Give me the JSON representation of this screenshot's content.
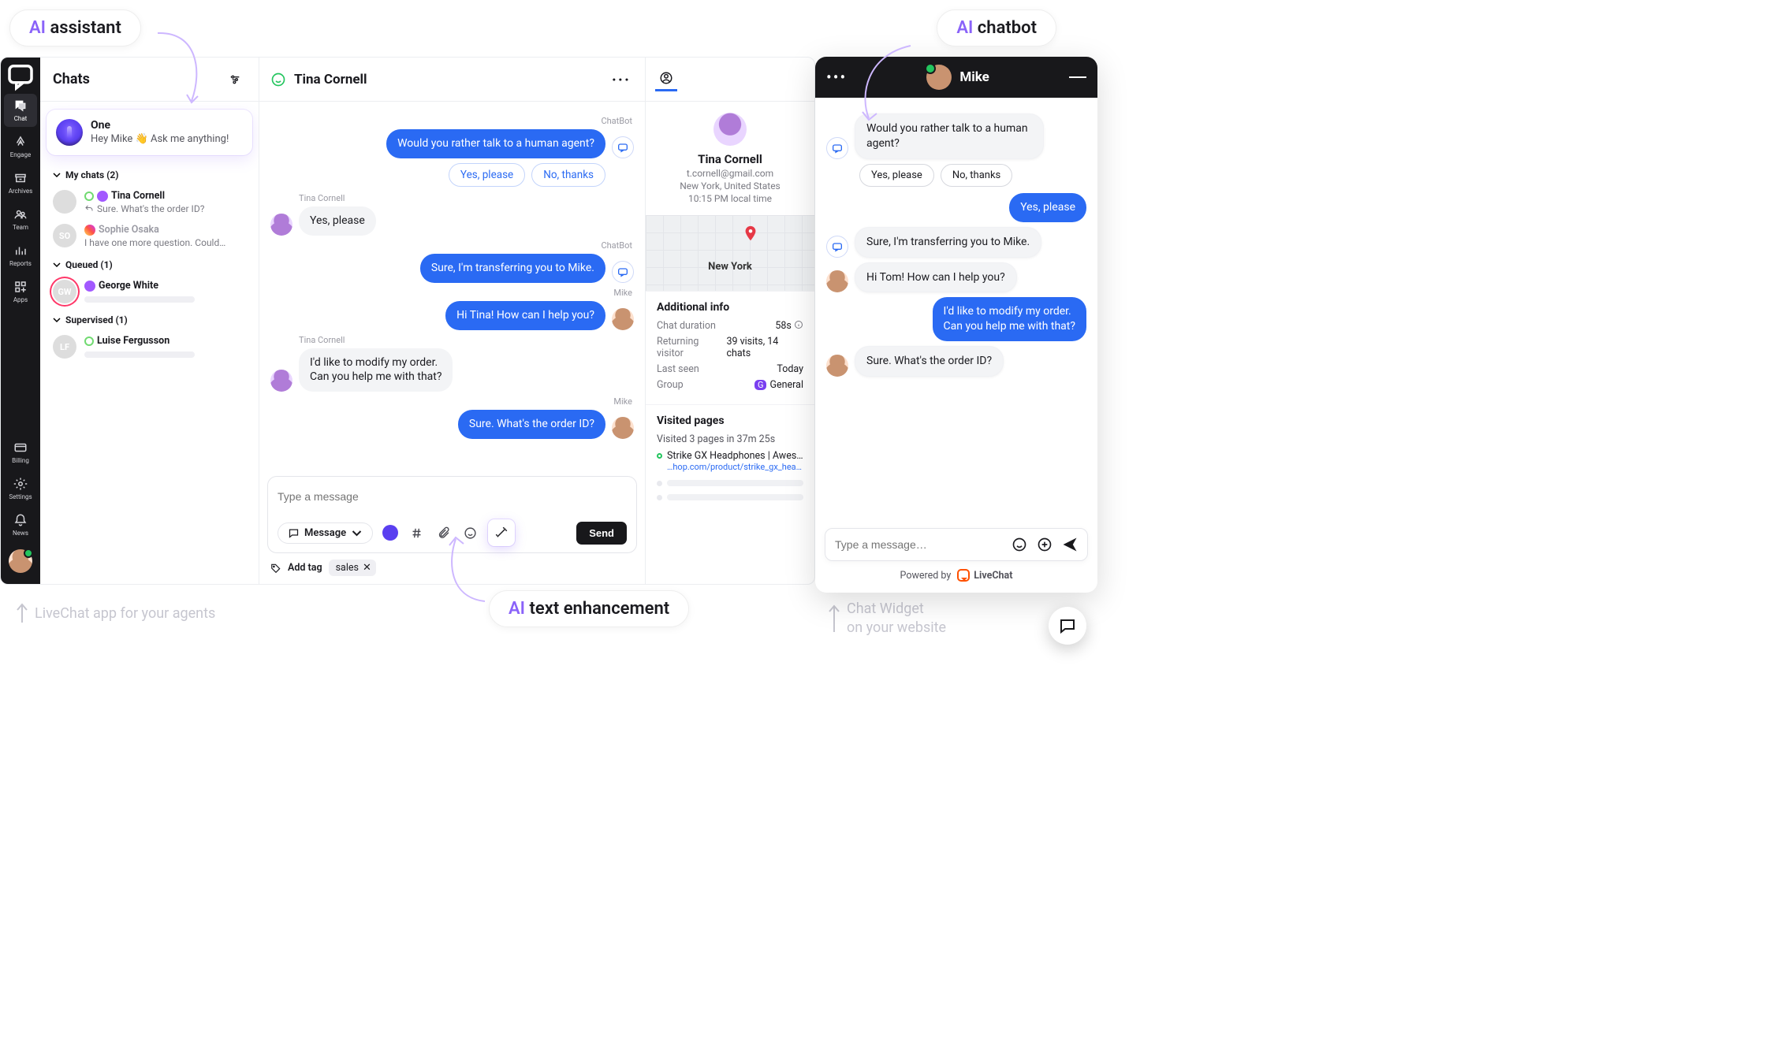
{
  "callouts": {
    "assistant_prefix": "AI",
    "assistant_rest": " assistant",
    "chatbot_prefix": "AI",
    "chatbot_rest": " chatbot",
    "enhance_prefix": "AI",
    "enhance_rest": " text enhancement"
  },
  "footnotes": {
    "left": "LiveChat app for your agents",
    "right_l1": "Chat Widget",
    "right_l2": "on your website"
  },
  "rail": {
    "items": [
      {
        "key": "chat",
        "label": "Chat"
      },
      {
        "key": "engage",
        "label": "Engage"
      },
      {
        "key": "archives",
        "label": "Archives"
      },
      {
        "key": "team",
        "label": "Team"
      },
      {
        "key": "reports",
        "label": "Reports"
      },
      {
        "key": "apps",
        "label": "Apps"
      }
    ],
    "bottom": [
      {
        "key": "billing",
        "label": "Billing"
      },
      {
        "key": "settings",
        "label": "Settings"
      },
      {
        "key": "news",
        "label": "News"
      }
    ]
  },
  "chats": {
    "title": "Chats",
    "one": {
      "title": "One",
      "sub_pre": "Hey Mike ",
      "sub_post": " Ask me anything!",
      "emoji": "👋"
    },
    "sections": {
      "my": "My chats (2)",
      "queued": "Queued (1)",
      "supervised": "Supervised (1)"
    },
    "items": {
      "tina": {
        "name": "Tina Cornell",
        "preview": "Sure. What's the order ID?"
      },
      "sophie": {
        "initials": "SO",
        "name": "Sophie Osaka",
        "preview": "I have one more question. Could…"
      },
      "george": {
        "initials": "GW",
        "name": "George White"
      },
      "luise": {
        "initials": "LF",
        "name": "Luise  Fergusson"
      }
    }
  },
  "conv": {
    "title": "Tina Cornell",
    "senders": {
      "bot": "ChatBot",
      "tina": "Tina Cornell",
      "mike": "Mike"
    },
    "m1": "Would you rather talk to a human agent?",
    "qr1": "Yes, please",
    "qr2": "No, thanks",
    "m2": "Yes, please",
    "m3": "Sure, I'm transferring you to Mike.",
    "m4": "Hi Tina! How can I help you?",
    "m5": "I'd like to modify my order.\nCan you help me with that?",
    "m6": "Sure. What's the order ID?",
    "composer_placeholder": "Type a message",
    "msg_type": "Message",
    "send": "Send",
    "add_tag": "Add tag",
    "tag": "sales"
  },
  "details": {
    "name": "Tina Cornell",
    "email": "t.cornell@gmail.com",
    "location": "New York, United States",
    "time": "10:15 PM local time",
    "city": "New York",
    "additional_title": "Additional info",
    "rows": {
      "dur_k": "Chat duration",
      "dur_v": "58s",
      "ret_k": "Returning visitor",
      "ret_v": "39 visits, 14 chats",
      "seen_k": "Last seen",
      "seen_v": "Today",
      "grp_k": "Group",
      "grp_badge": "G",
      "grp_v": "General"
    },
    "visited_title": "Visited pages",
    "visited_sub": "Visited 3 pages in 37m 25s",
    "page_title": "Strike GX Headphones | Awesome",
    "page_url": "…hop.com/product/strike_gx_headphon"
  },
  "widget": {
    "name": "Mike",
    "m1": "Would you rather talk to a human agent?",
    "qr1": "Yes, please",
    "qr2": "No, thanks",
    "m2": "Yes, please",
    "m3": "Sure, I'm transferring you to Mike.",
    "m4": "Hi Tom! How can I help you?",
    "m5": "I'd like to modify my order.\nCan you help me with that?",
    "m6": "Sure. What's the order ID?",
    "placeholder": "Type a message…",
    "powered": "Powered by",
    "brand": "LiveChat"
  }
}
